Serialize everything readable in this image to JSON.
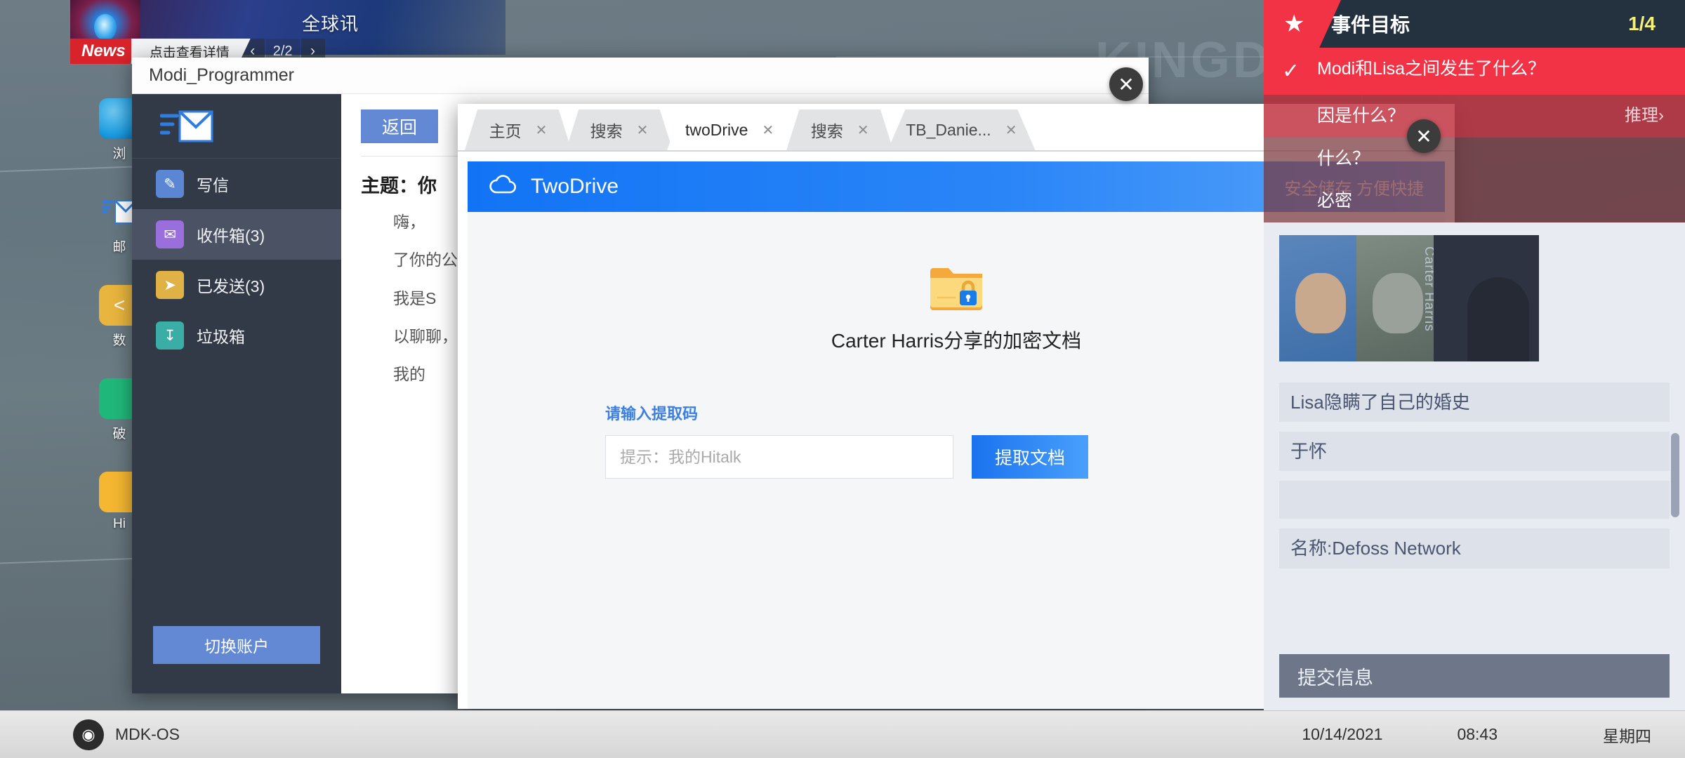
{
  "desktop": {
    "wallpaper_watermark": "KINGDO",
    "icons": [
      {
        "label": "浏",
        "icon": "browser-icon"
      },
      {
        "label": "邮",
        "icon": "mail-icon"
      },
      {
        "label": "数",
        "icon": "database-icon"
      },
      {
        "label": "破",
        "icon": "crack-tool-icon"
      },
      {
        "label": "Hi",
        "icon": "hitalk-icon"
      }
    ]
  },
  "news_banner": {
    "title": "全球讯",
    "tag": "News",
    "detail_label": "点击查看详情",
    "prev_icon": "‹",
    "next_icon": "›",
    "page_count": "2/2"
  },
  "mail_window": {
    "title": "Modi_Programmer",
    "logo_icon": "mail-logo-icon",
    "nav": [
      {
        "label": "写信",
        "icon": "compose-icon",
        "active": false
      },
      {
        "label": "收件箱(3)",
        "icon": "inbox-icon",
        "active": true
      },
      {
        "label": "已发送(3)",
        "icon": "sent-icon",
        "active": false
      },
      {
        "label": "垃圾箱",
        "icon": "trash-icon",
        "active": false
      }
    ],
    "switch_account_label": "切换账户",
    "back_label": "返回",
    "subject": "主题：你",
    "paragraphs": [
      "嗨，",
      "了你的公",
      "我是S",
      "以聊聊，",
      "我的"
    ]
  },
  "browser": {
    "tabs": [
      {
        "label": "主页",
        "active": false
      },
      {
        "label": "搜索",
        "active": false
      },
      {
        "label": "twoDrive",
        "active": true
      },
      {
        "label": "搜索",
        "active": false
      },
      {
        "label": "TB_Danie...",
        "active": false
      }
    ],
    "tab_close_icon": "✕",
    "close_icon": "✕"
  },
  "twodrive": {
    "brand": "TwoDrive",
    "brand_icon": "cloud-icon",
    "tagline": "安全储存 方便快捷",
    "folder_icon": "locked-folder-icon",
    "doc_title": "Carter Harris分享的加密文档",
    "code_label": "请输入提取码",
    "code_value": "",
    "code_placeholder": "提示：我的Hitalk",
    "extract_label": "提取文档",
    "accent_color": "#1a72ef"
  },
  "mission_panel": {
    "title": "事件目标",
    "star_icon": "star-icon",
    "progress": "1/4",
    "objectives": [
      {
        "check": "✓",
        "text": "Modi和Lisa之间发生了什么？",
        "link": "",
        "state": "done"
      },
      {
        "check": "",
        "text": "因是什么？",
        "link": "推理›",
        "state": "active"
      },
      {
        "check": "",
        "text": "什么？",
        "link": "",
        "state": "dim"
      },
      {
        "check": "",
        "text": "必密",
        "link": "",
        "state": "dim"
      }
    ],
    "portraits": [
      {
        "name": "",
        "id": "portrait-modi"
      },
      {
        "name": "Carter Harris",
        "id": "portrait-carter"
      },
      {
        "name": "",
        "id": "portrait-unknown"
      }
    ],
    "clues": [
      "Lisa隐瞒了自己的婚史",
      "于怀",
      "名称:Defoss Network"
    ],
    "submit_label": "提交信息"
  },
  "taskbar": {
    "os_icon": "mdk-os-icon",
    "os_name": "MDK-OS",
    "date": "10/14/2021",
    "time": "08:43",
    "weekday": "星期四"
  }
}
